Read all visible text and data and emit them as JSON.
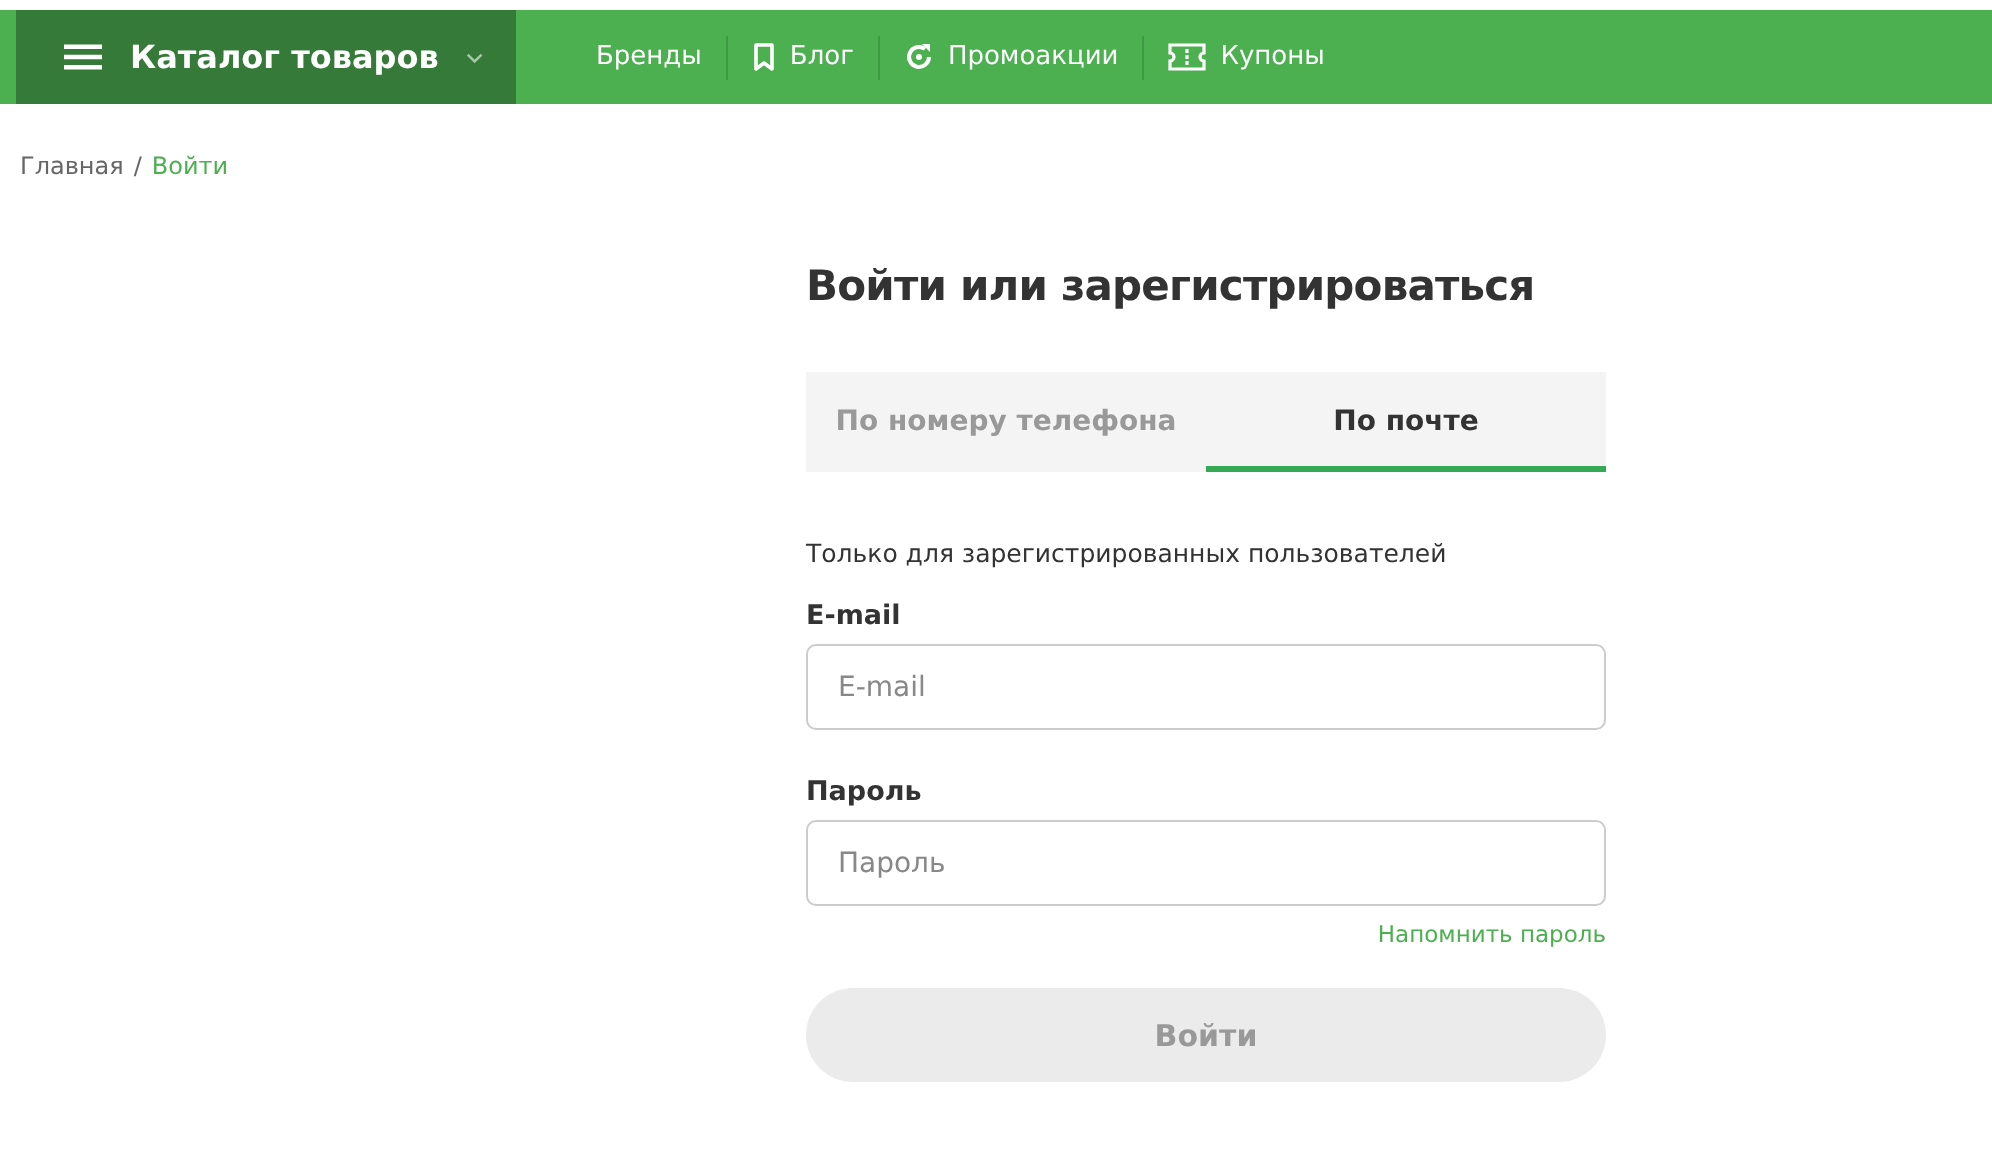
{
  "header": {
    "catalog": {
      "label": "Каталог товаров",
      "expanded": false
    },
    "nav": [
      {
        "label": "Бренды",
        "kind": "plain"
      },
      {
        "label": "Блог",
        "kind": "bookmark"
      },
      {
        "label": "Промоакции",
        "kind": "promo"
      },
      {
        "label": "Купоны",
        "kind": "coupon"
      }
    ]
  },
  "breadcrumb": [
    {
      "label": "Главная",
      "current": false
    },
    {
      "label": "Войти",
      "current": true
    }
  ],
  "breadcrumb_separator": "/",
  "login": {
    "title": "Войти или зарегистрироваться",
    "tabs": [
      {
        "label": "По номеру телефона",
        "selected": false
      },
      {
        "label": "По почте",
        "selected": true
      }
    ],
    "note": "Только для зарегистрированных пользователей",
    "fields": [
      {
        "label": "E-mail",
        "placeholder": "E-mail"
      },
      {
        "label": "Пароль",
        "placeholder": "Пароль"
      }
    ],
    "forgot_link": "Напомнить пароль",
    "submit": {
      "label": "Войти",
      "disabled": true
    }
  }
}
